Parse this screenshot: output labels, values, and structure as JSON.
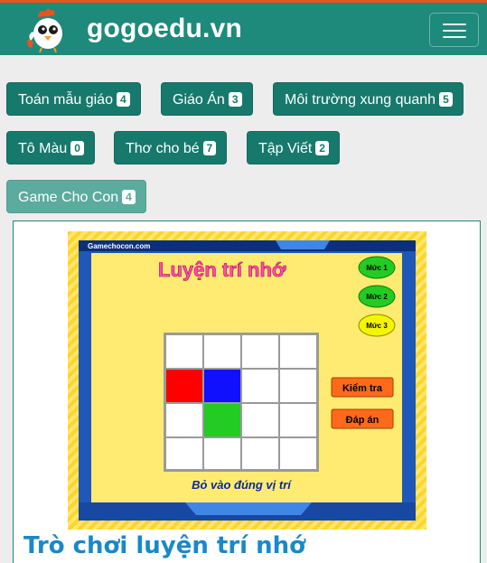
{
  "brand": {
    "name": "gogoedu.vn"
  },
  "categories": [
    {
      "label": "Toán mẫu giáo",
      "count": "4"
    },
    {
      "label": "Giáo Án",
      "count": "3"
    },
    {
      "label": "Môi trường xung quanh",
      "count": "5"
    },
    {
      "label": "Tô Màu",
      "count": "0"
    },
    {
      "label": "Thơ cho bé",
      "count": "7"
    },
    {
      "label": "Tập Viết",
      "count": "2"
    },
    {
      "label": "Game Cho Con",
      "count": "4"
    }
  ],
  "post": {
    "title": "Trò chơi luyện trí nhớ",
    "thumbnail": {
      "site": "Gamechocon.com",
      "heading": "Luyện trí nhớ",
      "levels": [
        "Mức 1",
        "Mức 2",
        "Mức 3"
      ],
      "check_button": "Kiểm tra",
      "answer_button": "Đáp án",
      "instruction": "Bỏ vào đúng vị trí"
    }
  },
  "colors": {
    "nav": "#1e8a7b",
    "accent_line": "#e8541d",
    "button": "#16796c",
    "title": "#1a88c9"
  }
}
